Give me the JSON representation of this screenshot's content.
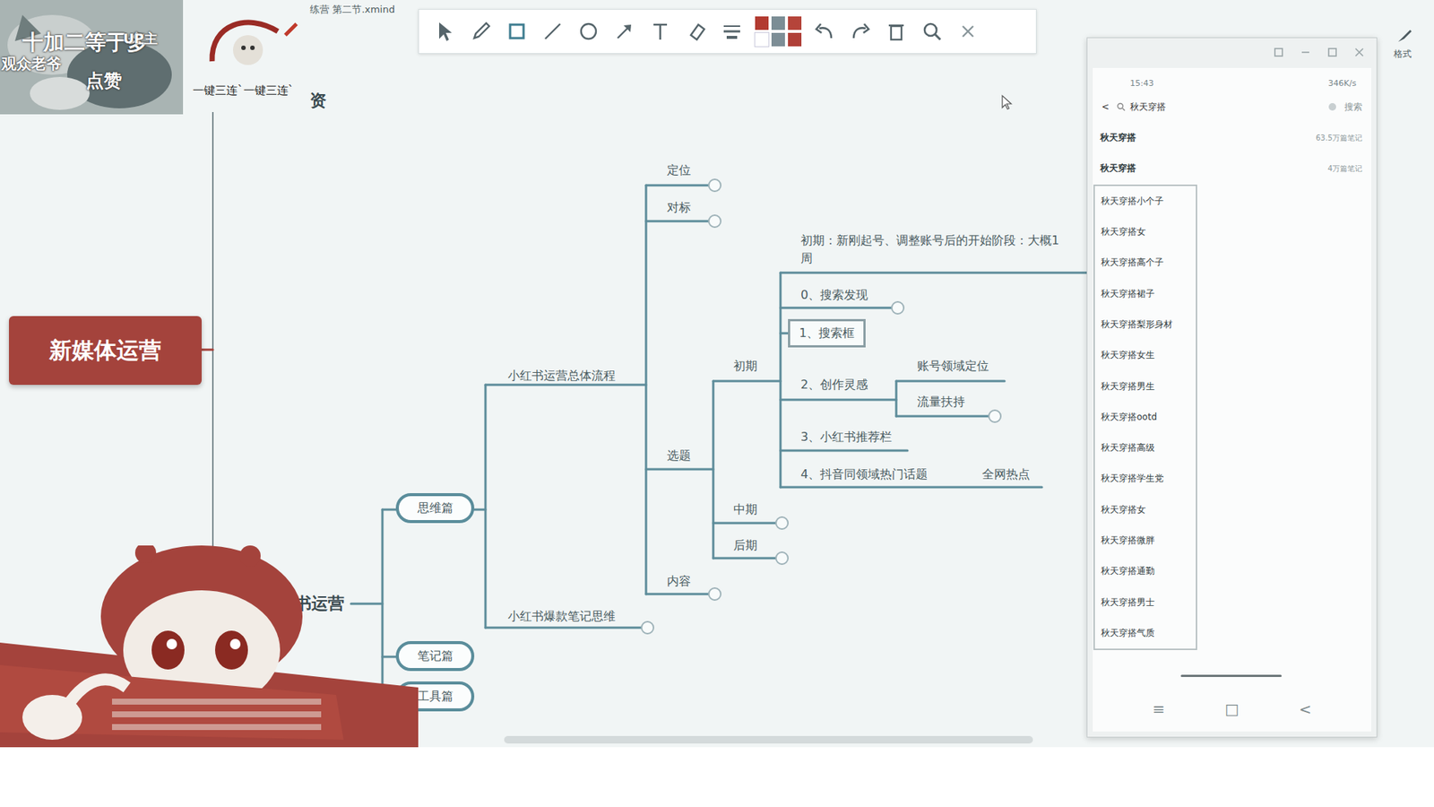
{
  "window": {
    "title": "练营 第二节.xmind"
  },
  "sticker": {
    "lines": [
      "十加二等于多",
      "UP主",
      "观众老爷",
      "点赞"
    ],
    "caption": "一键三连`一键三连`"
  },
  "toolbar": {
    "swatches": [
      {
        "color": "#b23a30"
      },
      {
        "color": "#7b8d95"
      },
      {
        "color": "#b5443a"
      },
      {
        "color": "#ffffff"
      },
      {
        "color": "#7d8e96"
      },
      {
        "color": "#b04038"
      }
    ]
  },
  "format_label": "格式",
  "mindmap": {
    "nodes": [
      {
        "text": "新媒体运营",
        "kind": "root"
      },
      {
        "text": "资",
        "kind": "label"
      },
      {
        "text": "书运营",
        "kind": "heading"
      },
      {
        "text": "思维篇",
        "kind": "pill"
      },
      {
        "text": "笔记篇",
        "kind": "pill"
      },
      {
        "text": "工具篇",
        "kind": "pill"
      },
      {
        "text": "小红书运营总体流程",
        "kind": "label"
      },
      {
        "text": "小红书爆款笔记思维",
        "kind": "label"
      },
      {
        "text": "定位",
        "kind": "label"
      },
      {
        "text": "对标",
        "kind": "label"
      },
      {
        "text": "选题",
        "kind": "label"
      },
      {
        "text": "内容",
        "kind": "label"
      },
      {
        "text": "初期",
        "kind": "label"
      },
      {
        "text": "中期",
        "kind": "label"
      },
      {
        "text": "后期",
        "kind": "label"
      },
      {
        "text": "初期：新刚起号、调整账号后的开始阶段：大概1",
        "kind": "label"
      },
      {
        "text": "周",
        "kind": "label"
      },
      {
        "text": "0、搜索发现",
        "kind": "label"
      },
      {
        "text": "1、搜索框",
        "kind": "boxed"
      },
      {
        "text": "2、创作灵感",
        "kind": "label"
      },
      {
        "text": "账号领域定位",
        "kind": "label"
      },
      {
        "text": "流量扶持",
        "kind": "label"
      },
      {
        "text": "3、小红书推荐栏",
        "kind": "label"
      },
      {
        "text": "4、抖音同领域热门话题",
        "kind": "label"
      },
      {
        "text": "全网热点",
        "kind": "label"
      }
    ]
  },
  "phone": {
    "time": "15:43",
    "network": "346K/s",
    "back": "<",
    "query": "秋天穿搭",
    "search_button": "搜索",
    "results": [
      {
        "text": "秋天穿搭",
        "count": "63.5万篇笔记"
      },
      {
        "text": "秋天穿搭",
        "count": "4万篇笔记"
      }
    ],
    "suggestions": [
      "秋天穿搭小个子",
      "秋天穿搭女",
      "秋天穿搭高个子",
      "秋天穿搭裙子",
      "秋天穿搭梨形身材",
      "秋天穿搭女生",
      "秋天穿搭男生",
      "秋天穿搭ootd",
      "秋天穿搭高级",
      "秋天穿搭学生党",
      "秋天穿搭女",
      "秋天穿搭微胖",
      "秋天穿搭通勤",
      "秋天穿搭男士",
      "秋天穿搭气质"
    ],
    "nav": [
      "≡",
      "□",
      "<"
    ]
  }
}
